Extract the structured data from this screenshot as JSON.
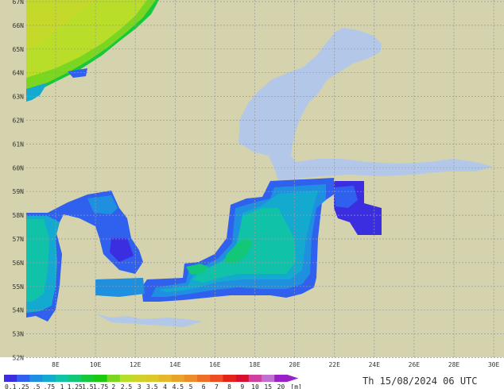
{
  "map": {
    "lat_labels": [
      "67N",
      "66N",
      "65N",
      "64N",
      "63N",
      "62N",
      "61N",
      "60N",
      "59N",
      "58N",
      "57N",
      "56N",
      "55N",
      "54N",
      "53N",
      "52N"
    ],
    "lon_labels": [
      "8E",
      "10E",
      "12E",
      "14E",
      "16E",
      "18E",
      "20E",
      "22E",
      "24E",
      "26E",
      "28E",
      "30E"
    ],
    "colors": {
      "land": "#d4d3ad",
      "sea_ice": "#b3c8e8",
      "grid": "#9a9a9a"
    }
  },
  "legend": {
    "labels": [
      "0.1",
      ".25",
      ".5",
      ".75",
      "1",
      "1.25",
      "1.5",
      "1.75",
      "2",
      "2.5",
      "3",
      "3.5",
      "4",
      "4.5",
      "5",
      "6",
      "7",
      "8",
      "9",
      "10",
      "15",
      "20"
    ],
    "unit": "[m]",
    "colors": [
      "#3a2ee0",
      "#2f60ee",
      "#1f8fe0",
      "#14aad0",
      "#10c2a8",
      "#12c878",
      "#16c83a",
      "#1cc810",
      "#7ad620",
      "#b8de2a",
      "#d0d22a",
      "#dcc82a",
      "#e4b82a",
      "#e8a42a",
      "#ec8c2a",
      "#ee6e28",
      "#ee4e24",
      "#e42418",
      "#d8102e",
      "#d040a0",
      "#c070d0",
      "#9a20c8"
    ]
  },
  "timestamp": "Th 15/08/2024 06 UTC"
}
